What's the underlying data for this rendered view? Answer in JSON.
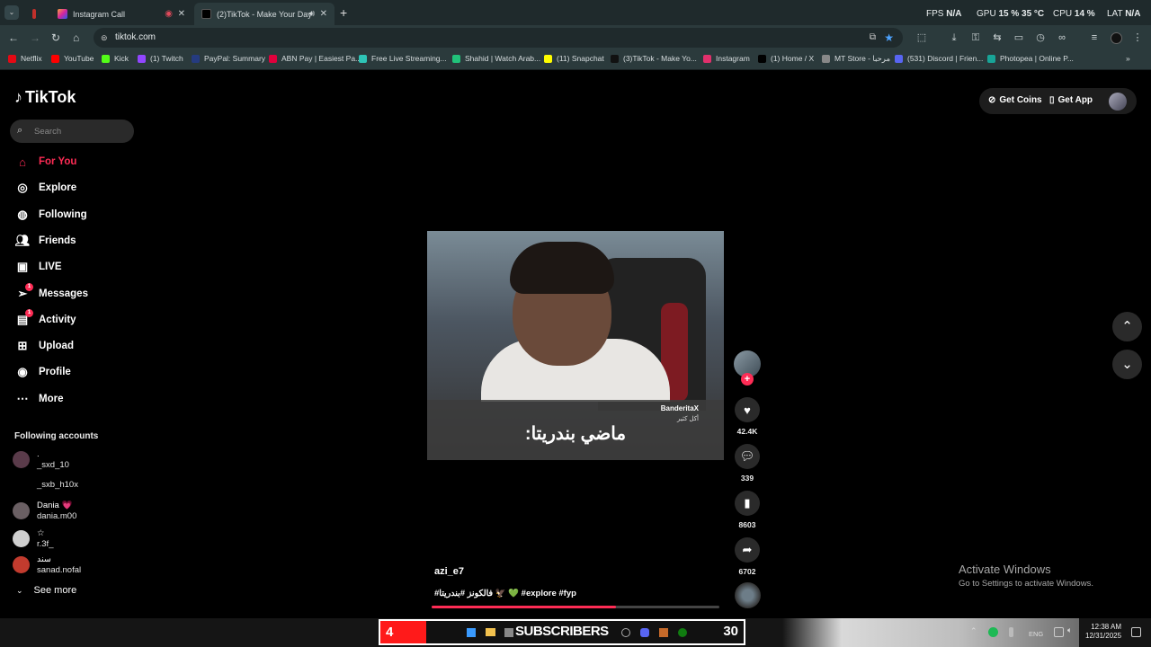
{
  "browser": {
    "tabs": [
      {
        "label": "Instagram Call",
        "active": false
      },
      {
        "label": "(2)TikTok - Make Your Day",
        "active": true
      }
    ],
    "perf": {
      "fps_label": "FPS",
      "fps": "N/A",
      "gpu_label": "GPU",
      "gpu": "15 % 35 °C",
      "cpu_label": "CPU",
      "cpu": "14 %",
      "lat_label": "LAT",
      "lat": "N/A"
    },
    "url": "tiktok.com",
    "bookmarks": [
      "Netflix",
      "YouTube",
      "Kick",
      "(1) Twitch",
      "PayPal: Summary",
      "ABN Pay | Easiest Pa...",
      "Free Live Streaming...",
      "Shahid | Watch Arab...",
      "(11) Snapchat",
      "(3)TikTok - Make Yo...",
      "Instagram",
      "(1) Home / X",
      "MT Store - مرحبا",
      "(531) Discord | Frien...",
      "Photopea | Online P..."
    ],
    "bookmark_colors": [
      "#e50914",
      "#ff0000",
      "#53fc18",
      "#9146ff",
      "#253b80",
      "#e0003c",
      "#2ec4b6",
      "#21c27a",
      "#fffc00",
      "#111111",
      "#e1306c",
      "#000000",
      "#888888",
      "#5865f2",
      "#18a497"
    ]
  },
  "tiktok": {
    "brand": "TikTok",
    "search_placeholder": "Search",
    "nav": [
      {
        "label": "For You",
        "icon": "home-icon",
        "active": true
      },
      {
        "label": "Explore",
        "icon": "compass-icon"
      },
      {
        "label": "Following",
        "icon": "following-icon"
      },
      {
        "label": "Friends",
        "icon": "friends-icon"
      },
      {
        "label": "LIVE",
        "icon": "live-icon"
      },
      {
        "label": "Messages",
        "icon": "messages-icon",
        "badge": "1"
      },
      {
        "label": "Activity",
        "icon": "activity-icon",
        "badge": "1"
      },
      {
        "label": "Upload",
        "icon": "upload-icon"
      },
      {
        "label": "Profile",
        "icon": "profile-icon"
      },
      {
        "label": "More",
        "icon": "more-icon"
      }
    ],
    "following_title": "Following accounts",
    "following": [
      {
        "name": ".",
        "user": "_sxd_10"
      },
      {
        "name": "",
        "user": "_sxb_h10x"
      },
      {
        "name": "Dania 💗",
        "user": "dania.m00"
      },
      {
        "name": "☆",
        "user": "r.3f_"
      },
      {
        "name": "سند",
        "user": "sanad.nofal"
      }
    ],
    "see_more": "See more",
    "get_coins": "Get Coins",
    "get_app": "Get App"
  },
  "video": {
    "overlay_user": "BanderitaX",
    "overlay_sub": "أكل كثير",
    "caption_ar": "ماضي بندريتا:",
    "author": "azi_e7",
    "tags": "#فالكونز #بندريتا 🦅 💚 #explore #fyp",
    "progress": 0.64,
    "likes": "42.4K",
    "comments": "339",
    "saves": "8603",
    "shares": "6702"
  },
  "windows": {
    "activate_title": "Activate Windows",
    "activate_sub": "Go to Settings to activate Windows.",
    "sub_number": "4",
    "sub_label": "SUBSCRIBERS",
    "sub_count": "30",
    "lang": "ENG",
    "time": "12:38 AM",
    "date": "12/31/2025"
  }
}
